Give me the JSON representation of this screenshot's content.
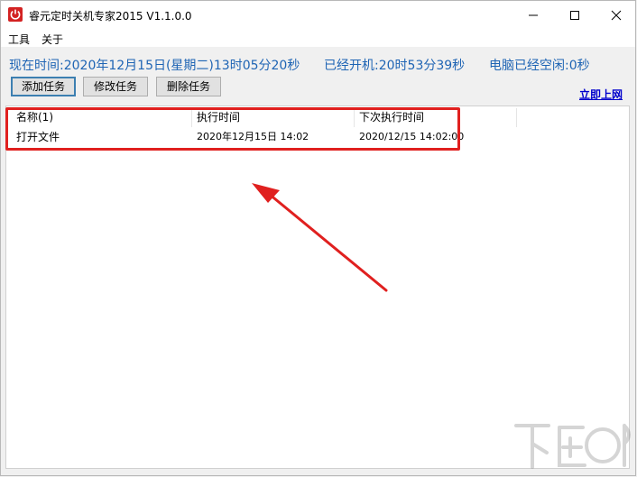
{
  "window": {
    "title": "睿元定时关机专家2015 V1.1.0.0"
  },
  "menu": {
    "items": [
      "工具",
      "关于"
    ]
  },
  "status": {
    "current_time": "现在时间:2020年12月15日(星期二)13时05分20秒",
    "uptime": "已经开机:20时53分39秒",
    "idle": "电脑已经空闲:0秒"
  },
  "toolbar": {
    "add_label": "添加任务",
    "edit_label": "修改任务",
    "delete_label": "删除任务",
    "online_link": "立即上网"
  },
  "list": {
    "columns": [
      "名称(1)",
      "执行时间",
      "下次执行时间"
    ],
    "rows": [
      {
        "name": "打开文件",
        "exec_time": "2020年12月15日 14:02",
        "next_time": "2020/12/15 14:02:00"
      }
    ]
  },
  "colors": {
    "status_text": "#1e64b4",
    "annotation_red": "#e0201f",
    "link_blue": "#0000cc"
  },
  "icons": [
    "power-icon",
    "minimize-icon",
    "maximize-icon",
    "close-icon"
  ]
}
